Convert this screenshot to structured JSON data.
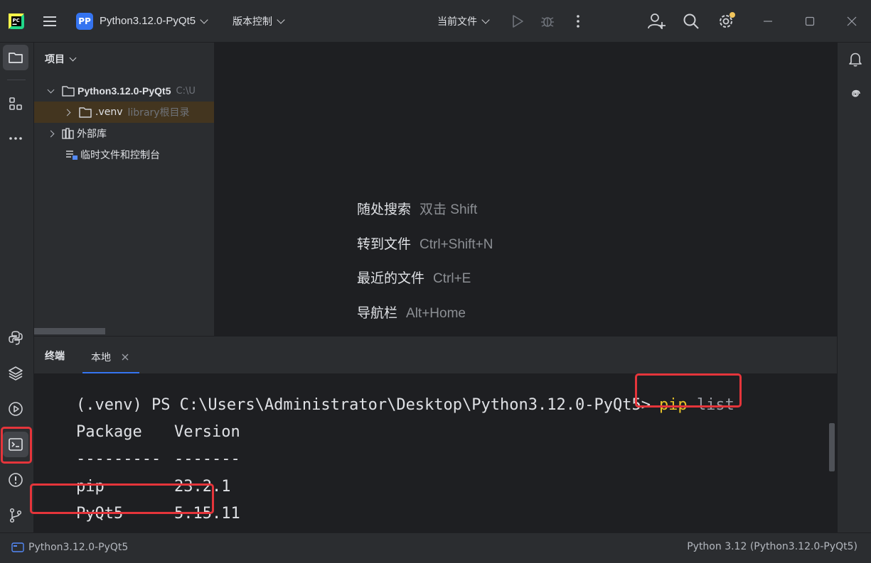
{
  "titlebar": {
    "project_badge": "PP",
    "project_name": "Python3.12.0-PyQt5",
    "vcs_label": "版本控制",
    "run_config": "当前文件"
  },
  "project_panel": {
    "title": "项目",
    "tree": [
      {
        "label": "Python3.12.0-PyQt5",
        "hint": "C:\\U"
      },
      {
        "label": ".venv",
        "hint": "library根目录"
      },
      {
        "label": "外部库",
        "hint": ""
      },
      {
        "label": "临时文件和控制台",
        "hint": ""
      }
    ]
  },
  "editor": {
    "hints": [
      {
        "action": "随处搜索",
        "shortcut": "双击 Shift"
      },
      {
        "action": "转到文件",
        "shortcut": "Ctrl+Shift+N"
      },
      {
        "action": "最近的文件",
        "shortcut": "Ctrl+E"
      },
      {
        "action": "导航栏",
        "shortcut": "Alt+Home"
      }
    ]
  },
  "terminal": {
    "title": "终端",
    "tab_label": "本地",
    "prompt": "(.venv) PS C:\\Users\\Administrator\\Desktop\\Python3.12.0-PyQt5>",
    "command_word": "pip",
    "command_arg": "list",
    "header": {
      "col1": "Package",
      "col2": "Version"
    },
    "separator": {
      "col1": "---------",
      "col2": "-------"
    },
    "rows": [
      {
        "package": "pip",
        "version": "23.2.1"
      },
      {
        "package": "PyQt5",
        "version": "5.15.11"
      }
    ]
  },
  "statusbar": {
    "project": "Python3.12.0-PyQt5",
    "interpreter": "Python 3.12 (Python3.12.0-PyQt5)"
  },
  "colors": {
    "accent_red": "#e5353b",
    "command_yellow": "#e6c229",
    "badge_blue": "#3574f0"
  }
}
